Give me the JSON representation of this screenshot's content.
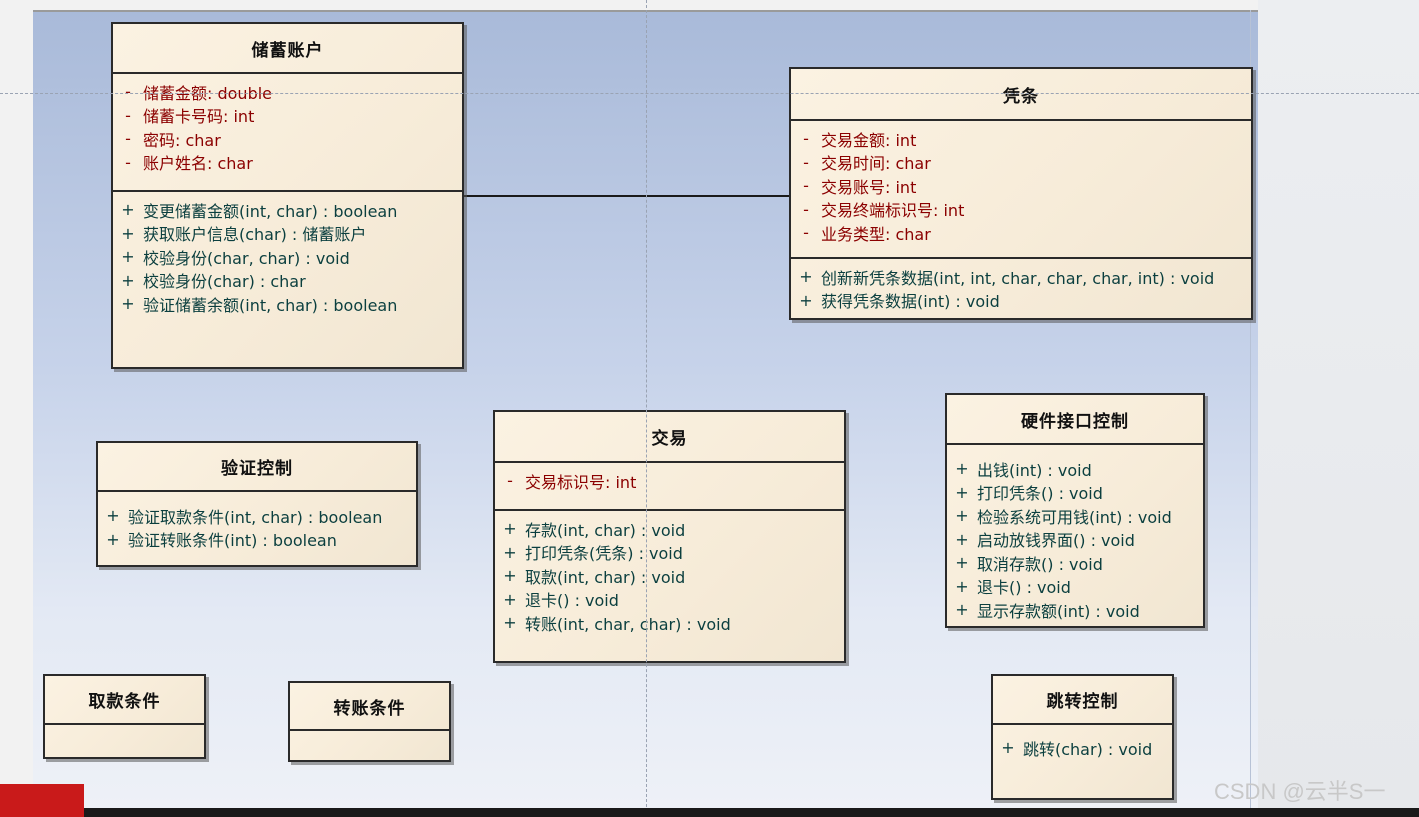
{
  "diagram": {
    "classes": {
      "savings": {
        "name": "储蓄账户",
        "attributes": [
          {
            "vis": "-",
            "text": "储蓄金额: double"
          },
          {
            "vis": "-",
            "text": "储蓄卡号码: int"
          },
          {
            "vis": "-",
            "text": "密码: char"
          },
          {
            "vis": "-",
            "text": "账户姓名: char"
          }
        ],
        "operations": [
          {
            "vis": "+",
            "text": "变更储蓄金额(int, char) : boolean"
          },
          {
            "vis": "+",
            "text": "获取账户信息(char) : 储蓄账户"
          },
          {
            "vis": "+",
            "text": "校验身份(char, char) : void"
          },
          {
            "vis": "+",
            "text": "校验身份(char) : char"
          },
          {
            "vis": "+",
            "text": "验证储蓄余额(int, char) : boolean"
          }
        ]
      },
      "voucher": {
        "name": "凭条",
        "attributes": [
          {
            "vis": "-",
            "text": "交易金额: int"
          },
          {
            "vis": "-",
            "text": "交易时间: char"
          },
          {
            "vis": "-",
            "text": "交易账号: int"
          },
          {
            "vis": "-",
            "text": "交易终端标识号: int"
          },
          {
            "vis": "-",
            "text": "业务类型: char"
          }
        ],
        "operations": [
          {
            "vis": "+",
            "text": "创新新凭条数据(int, int, char, char, char, int) : void"
          },
          {
            "vis": "+",
            "text": "获得凭条数据(int) : void"
          }
        ]
      },
      "verify": {
        "name": "验证控制",
        "attributes": [],
        "operations": [
          {
            "vis": "+",
            "text": "验证取款条件(int, char) : boolean"
          },
          {
            "vis": "+",
            "text": "验证转账条件(int) : boolean"
          }
        ]
      },
      "transaction": {
        "name": "交易",
        "attributes": [
          {
            "vis": "-",
            "text": "交易标识号: int"
          }
        ],
        "operations": [
          {
            "vis": "+",
            "text": "存款(int, char) : void"
          },
          {
            "vis": "+",
            "text": "打印凭条(凭条) : void"
          },
          {
            "vis": "+",
            "text": "取款(int, char) : void"
          },
          {
            "vis": "+",
            "text": "退卡() : void"
          },
          {
            "vis": "+",
            "text": "转账(int, char, char) : void"
          }
        ]
      },
      "hardware": {
        "name": "硬件接口控制",
        "attributes": [],
        "operations": [
          {
            "vis": "+",
            "text": "出钱(int) : void"
          },
          {
            "vis": "+",
            "text": "打印凭条() : void"
          },
          {
            "vis": "+",
            "text": "检验系统可用钱(int) : void"
          },
          {
            "vis": "+",
            "text": "启动放钱界面() : void"
          },
          {
            "vis": "+",
            "text": "取消存款() : void"
          },
          {
            "vis": "+",
            "text": "退卡() : void"
          },
          {
            "vis": "+",
            "text": "显示存款额(int) : void"
          }
        ]
      },
      "withdraw_cond": {
        "name": "取款条件",
        "attributes": [],
        "operations": []
      },
      "transfer_cond": {
        "name": "转账条件",
        "attributes": [],
        "operations": []
      },
      "jump": {
        "name": "跳转控制",
        "attributes": [],
        "operations": [
          {
            "vis": "+",
            "text": "跳转(char) : void"
          }
        ]
      }
    }
  },
  "watermark": "CSDN @云半S一",
  "colors": {
    "attribute_text": "#8b0000",
    "operation_text": "#0b3f3f",
    "class_fill": "#f7ecd9",
    "canvas_top": "#a9bad9",
    "canvas_bottom": "#eef1f7"
  }
}
